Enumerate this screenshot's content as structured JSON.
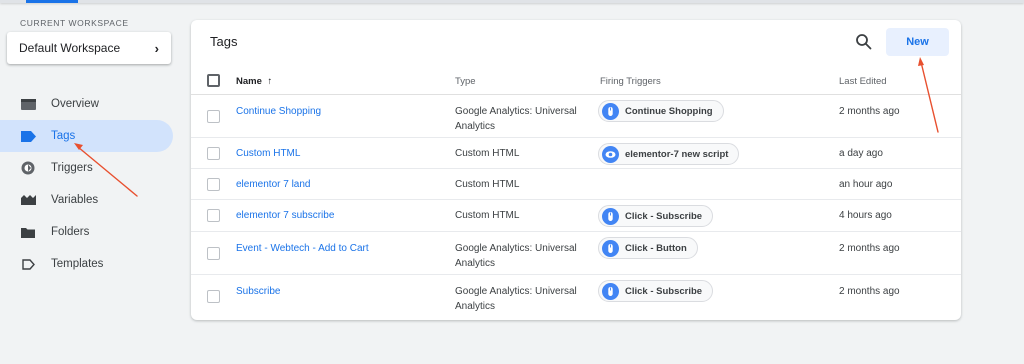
{
  "sidebar": {
    "workspace_label": "CURRENT WORKSPACE",
    "workspace_name": "Default Workspace",
    "items": [
      {
        "label": "Overview",
        "icon": "overview-icon"
      },
      {
        "label": "Tags",
        "icon": "tag-icon",
        "active": true
      },
      {
        "label": "Triggers",
        "icon": "trigger-icon"
      },
      {
        "label": "Variables",
        "icon": "variables-icon"
      },
      {
        "label": "Folders",
        "icon": "folder-icon"
      },
      {
        "label": "Templates",
        "icon": "template-icon"
      }
    ]
  },
  "main": {
    "title": "Tags",
    "new_button": "New",
    "columns": {
      "name": "Name",
      "sort_indicator": "↑",
      "type": "Type",
      "triggers": "Firing Triggers",
      "edited": "Last Edited"
    },
    "rows": [
      {
        "name": "Continue Shopping",
        "type_line1": "Google Analytics: Universal",
        "type_line2": "Analytics",
        "trigger": "Continue Shopping",
        "trigger_icon": "click-trigger-icon",
        "edited": "2 months ago"
      },
      {
        "name": "Custom HTML",
        "type_line1": "Custom HTML",
        "type_line2": "",
        "trigger": "elementor-7 new script",
        "trigger_icon": "pageview-trigger-icon",
        "edited": "a day ago"
      },
      {
        "name": "elementor 7 land",
        "type_line1": "Custom HTML",
        "type_line2": "",
        "trigger": "",
        "trigger_icon": "",
        "edited": "an hour ago"
      },
      {
        "name": "elementor 7 subscribe",
        "type_line1": "Custom HTML",
        "type_line2": "",
        "trigger": "Click - Subscribe",
        "trigger_icon": "click-trigger-icon",
        "edited": "4 hours ago"
      },
      {
        "name": "Event - Webtech - Add to Cart",
        "type_line1": "Google Analytics: Universal",
        "type_line2": "Analytics",
        "trigger": "Click - Button",
        "trigger_icon": "click-trigger-icon",
        "edited": "2 months ago"
      },
      {
        "name": "Subscribe",
        "type_line1": "Google Analytics: Universal",
        "type_line2": "Analytics",
        "trigger": "Click - Subscribe",
        "trigger_icon": "click-trigger-icon",
        "edited": "2 months ago"
      }
    ]
  },
  "colors": {
    "accent": "#1a73e8",
    "active_nav_bg": "#d2e3fc",
    "annotation_arrow": "#e8502f",
    "trigger_icon_bg": "#4285f4"
  }
}
